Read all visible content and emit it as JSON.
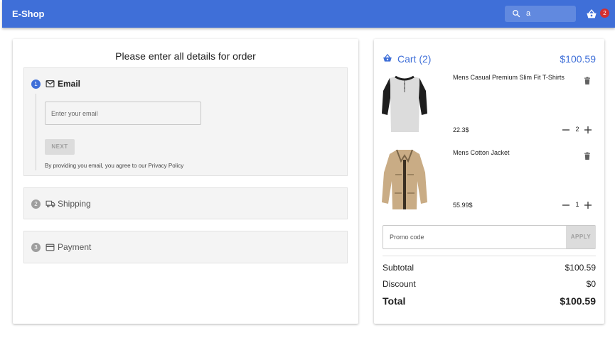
{
  "appbar": {
    "brand": "E-Shop",
    "search_value": "a",
    "cart_badge": "2"
  },
  "order": {
    "title": "Please enter all details for order",
    "steps": [
      {
        "number": "1",
        "label": "Email",
        "icon": "mail-icon"
      },
      {
        "number": "2",
        "label": "Shipping",
        "icon": "truck-icon"
      },
      {
        "number": "3",
        "label": "Payment",
        "icon": "credit-card-icon"
      }
    ],
    "email_placeholder": "Enter your email",
    "next_label": "NEXT",
    "privacy_text": "By providing you email, you agree to our Privacy Policy"
  },
  "cart": {
    "title": "Cart (2)",
    "total": "$100.59",
    "items": [
      {
        "name": "Mens Casual Premium Slim Fit T-Shirts",
        "price": "22.3$",
        "quantity": "2"
      },
      {
        "name": "Mens Cotton Jacket",
        "price": "55.99$",
        "quantity": "1"
      }
    ],
    "promo_placeholder": "Promo code",
    "apply_label": "APPLY",
    "subtotal_label": "Subtotal",
    "subtotal_value": "$100.59",
    "discount_label": "Discount",
    "discount_value": "$0",
    "total_label": "Total",
    "total_value": "$100.59"
  },
  "colors": {
    "primary": "#3f6fd8",
    "badge": "#d32f2f"
  }
}
